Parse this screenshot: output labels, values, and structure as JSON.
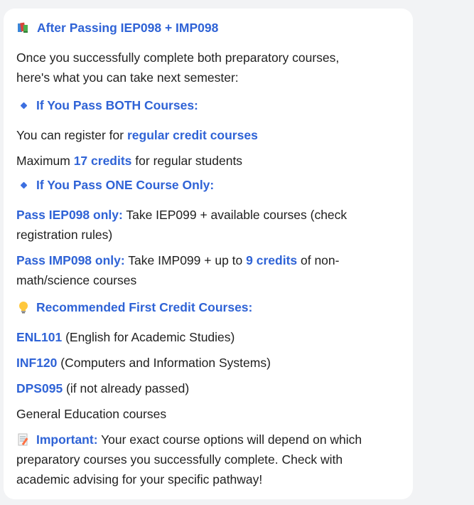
{
  "title": "After Passing IEP098 + IMP098",
  "intro": {
    "line1": "Once you successfully complete both preparatory courses,",
    "line2": "here's what you can take next semester:"
  },
  "section_both": {
    "heading": "If You Pass BOTH Courses:",
    "register_prefix": "You can register for ",
    "register_highlight": "regular credit courses",
    "max_prefix": "Maximum ",
    "max_highlight": "17 credits",
    "max_suffix": " for regular students"
  },
  "section_one": {
    "heading": "If You Pass ONE Course Only:",
    "iep_label": "Pass IEP098 only:",
    "iep_text_line1": " Take IEP099 + available courses (check",
    "iep_text_line2": "registration rules)",
    "imp_label": "Pass IMP098 only:",
    "imp_text_a": " Take IMP099 + up to ",
    "imp_highlight": "9 credits",
    "imp_text_b": " of non-",
    "imp_text_line2": "math/science courses"
  },
  "section_recommended": {
    "heading": "Recommended First Credit Courses:",
    "courses": [
      {
        "code": "ENL101",
        "desc": " (English for Academic Studies)"
      },
      {
        "code": "INF120",
        "desc": " (Computers and Information Systems)"
      },
      {
        "code": "DPS095",
        "desc": " (if not already passed)"
      }
    ],
    "general": "General Education courses"
  },
  "important": {
    "label": "Important:",
    "line1": " Your exact course options will depend on which",
    "line2": "preparatory courses you successfully complete. Check with",
    "line3": "academic advising for your specific pathway!"
  },
  "icons": {
    "title_icon": "books-icon",
    "bullet_icon": "small-blue-diamond-icon",
    "recommended_icon": "light-bulb-icon",
    "important_icon": "memo-icon"
  },
  "colors": {
    "accent": "#2f63d6",
    "text": "#1f1f1f",
    "background": "#f2f3f5",
    "card": "#ffffff"
  }
}
